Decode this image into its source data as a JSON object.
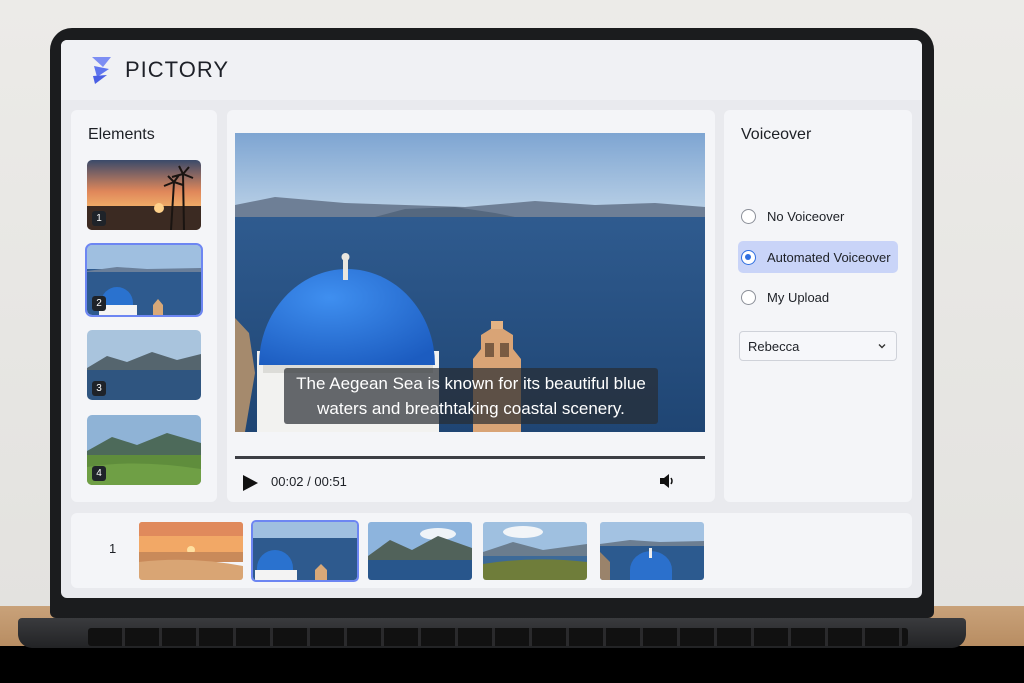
{
  "app": {
    "brand": "PICTORY"
  },
  "elements": {
    "title": "Elements",
    "items": [
      {
        "number": "1",
        "scene": "palm trees at sunset"
      },
      {
        "number": "2",
        "scene": "blue dome over sea"
      },
      {
        "number": "3",
        "scene": "coastal hills"
      },
      {
        "number": "4",
        "scene": "green valley"
      }
    ]
  },
  "player": {
    "caption_line1": "The Aegean Sea is known for its beautiful blue",
    "caption_line2": "waters and breathtaking coastal scenery.",
    "time": "00:02 / 00:51",
    "icons": {
      "play": "play-icon",
      "volume": "volume-icon"
    }
  },
  "voiceover": {
    "title": "Voiceover",
    "options": [
      {
        "label": "No Voiceover",
        "selected": false
      },
      {
        "label": "Automated Voiceover",
        "selected": true
      },
      {
        "label": "My Upload",
        "selected": false
      }
    ],
    "voice_select": "Rebecca"
  },
  "timeline": {
    "scene_number": "1"
  },
  "colors": {
    "accent": "#6d86f2",
    "radio_selected": "#2f6fe0",
    "selected_option_bg": "#c9d4f8"
  }
}
